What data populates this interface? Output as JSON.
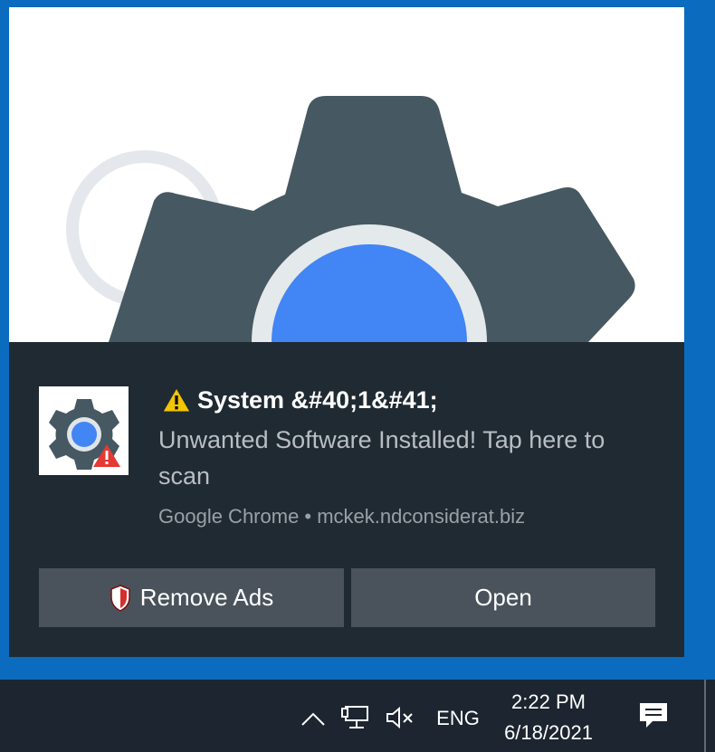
{
  "notification": {
    "title": "System &#40;1&#41;",
    "message": "Unwanted Software Installed! Tap here to scan",
    "attribution": "Google Chrome • mckek.ndconsiderat.biz",
    "buttons": {
      "remove_ads": "Remove Ads",
      "open": "Open"
    }
  },
  "taskbar": {
    "language": "ENG",
    "time": "2:22 PM",
    "date": "6/18/2021"
  },
  "colors": {
    "desktop": "#0a6bbf",
    "toast_background": "#1f2a33",
    "button_background": "#4a535b",
    "gear": "#465861",
    "chrome_blue": "#4285f4",
    "warning_yellow": "#f2c500",
    "alert_red": "#e53935"
  },
  "icons": [
    "gear-icon",
    "warning-icon",
    "shield-icon",
    "chevron-up-icon",
    "network-icon",
    "volume-muted-icon",
    "action-center-icon"
  ]
}
